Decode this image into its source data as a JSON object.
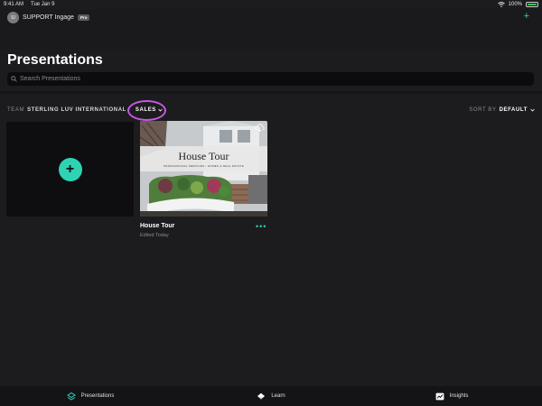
{
  "status_bar": {
    "time": "9:41 AM",
    "date": "Tue Jan 9",
    "battery_percent": "100%"
  },
  "header": {
    "avatar_initials": "SI",
    "account_name": "SUPPORT Ingage",
    "plan_badge": "Pro",
    "title": "Presentations"
  },
  "search": {
    "placeholder": "Search Presentations"
  },
  "filter": {
    "team_prefix": "TEAM",
    "team_name": "STERLING LUV INTERNATIONAL",
    "department": "SALES",
    "sort_prefix": "SORT BY",
    "sort_value": "DEFAULT"
  },
  "presentations": [
    {
      "thumbnail_title": "House Tour",
      "thumbnail_subtitle": "PROFESSIONAL SERVICES / HOMES & REAL ESTATE",
      "title": "House Tour",
      "meta": "Edited Today"
    }
  ],
  "tabs": [
    {
      "label": "Presentations",
      "icon": "presentations-icon"
    },
    {
      "label": "Learn",
      "icon": "learn-icon"
    },
    {
      "label": "Insights",
      "icon": "insights-icon"
    }
  ],
  "colors": {
    "accent": "#2fd3b3",
    "highlight": "#c858e0",
    "background": "#1c1c1f"
  }
}
